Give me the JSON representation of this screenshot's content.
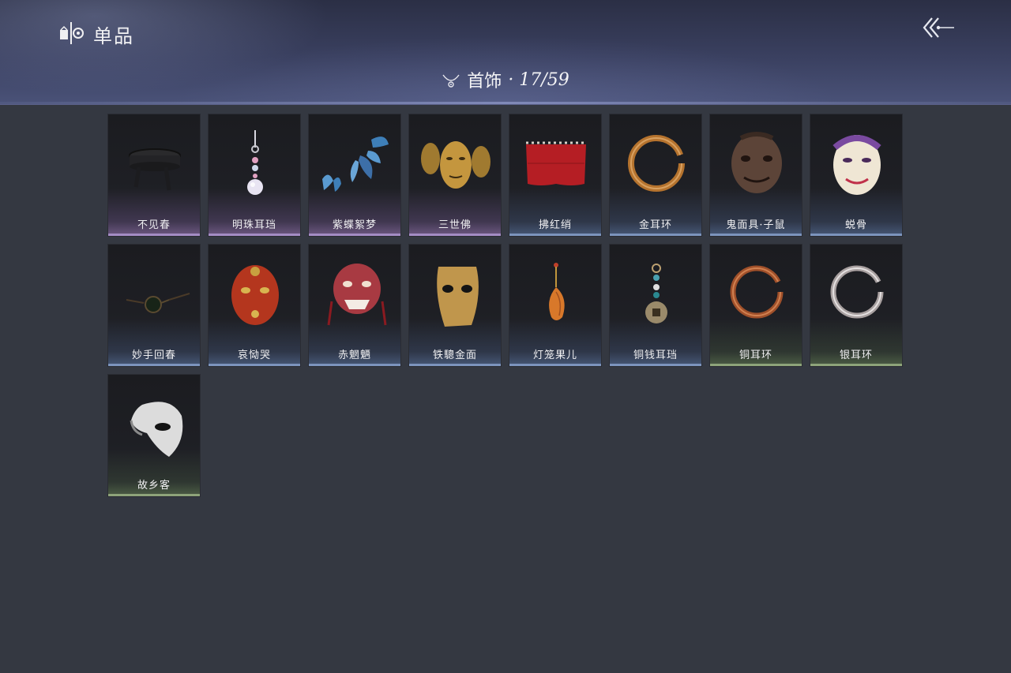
{
  "header": {
    "title": "单品",
    "logo_icon": "collection-icon",
    "back_icon": "double-chevron-left-icon"
  },
  "category": {
    "icon": "necklace-icon",
    "name": "首饰",
    "count": "· 17/59"
  },
  "items": [
    {
      "name": "不见春",
      "rarity": "purple",
      "icon": "blindfold-icon"
    },
    {
      "name": "明珠耳珰",
      "rarity": "purple",
      "icon": "pearl-earring-icon"
    },
    {
      "name": "紫蝶絮梦",
      "rarity": "purple",
      "icon": "butterfly-icon"
    },
    {
      "name": "三世佛",
      "rarity": "purple",
      "icon": "three-face-mask-icon"
    },
    {
      "name": "拂红绡",
      "rarity": "blue",
      "icon": "red-veil-icon"
    },
    {
      "name": "金耳环",
      "rarity": "blue",
      "icon": "gold-earring-icon"
    },
    {
      "name": "鬼面具·子鼠",
      "rarity": "blue",
      "icon": "rat-mask-icon"
    },
    {
      "name": "蜕骨",
      "rarity": "blue",
      "icon": "white-mask-icon"
    },
    {
      "name": "妙手回春",
      "rarity": "blue",
      "icon": "spectacles-icon"
    },
    {
      "name": "哀恸哭",
      "rarity": "blue",
      "icon": "red-mask-icon"
    },
    {
      "name": "赤魍魉",
      "rarity": "blue",
      "icon": "demon-mask-icon"
    },
    {
      "name": "铁驄金面",
      "rarity": "blue",
      "icon": "gold-mask-icon"
    },
    {
      "name": "灯笼果儿",
      "rarity": "blue",
      "icon": "lantern-fruit-icon"
    },
    {
      "name": "铜钱耳珰",
      "rarity": "blue",
      "icon": "coin-earring-icon"
    },
    {
      "name": "铜耳环",
      "rarity": "green",
      "icon": "copper-earring-icon"
    },
    {
      "name": "银耳环",
      "rarity": "green",
      "icon": "silver-earring-icon"
    },
    {
      "name": "故乡客",
      "rarity": "green",
      "icon": "half-mask-icon"
    }
  ]
}
